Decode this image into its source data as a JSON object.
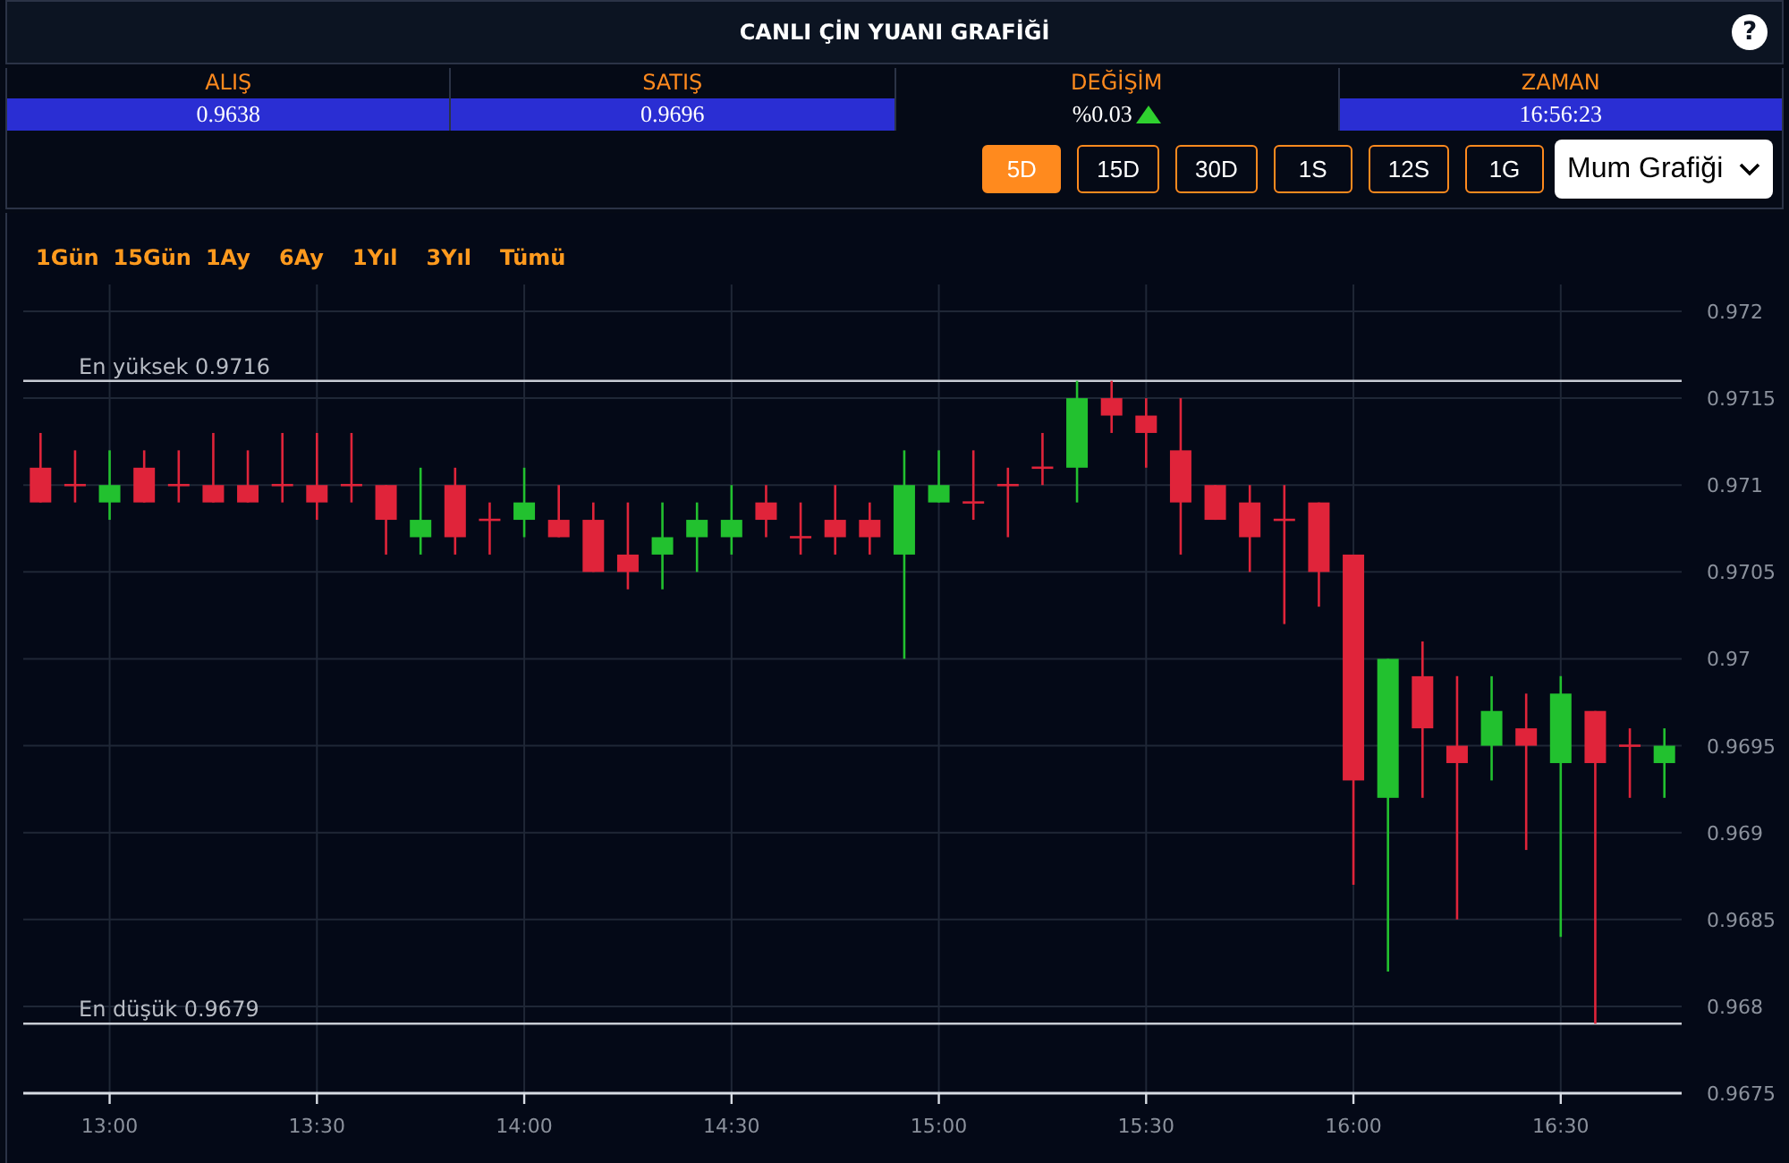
{
  "header": {
    "title": "CANLI ÇİN YUANI GRAFİĞİ",
    "help": "?"
  },
  "quotes": [
    {
      "label": "ALIŞ",
      "value": "0.9638",
      "highlighted": true,
      "up_arrow": false
    },
    {
      "label": "SATIŞ",
      "value": "0.9696",
      "highlighted": true,
      "up_arrow": false
    },
    {
      "label": "DEĞİŞİM",
      "value": "%0.03",
      "highlighted": false,
      "up_arrow": true
    },
    {
      "label": "ZAMAN",
      "value": "16:56:23",
      "highlighted": true,
      "up_arrow": false
    }
  ],
  "periods": [
    {
      "label": "5D",
      "selected": true
    },
    {
      "label": "15D",
      "selected": false
    },
    {
      "label": "30D",
      "selected": false
    },
    {
      "label": "1S",
      "selected": false
    },
    {
      "label": "12S",
      "selected": false
    },
    {
      "label": "1G",
      "selected": false
    }
  ],
  "chart_type": {
    "value": "Mum Grafiği"
  },
  "ranges": [
    {
      "label": "1Gün"
    },
    {
      "label": "15Gün"
    },
    {
      "label": "1Ay"
    },
    {
      "label": "6Ay"
    },
    {
      "label": "1Yıl"
    },
    {
      "label": "3Yıl"
    },
    {
      "label": "Tümü"
    }
  ],
  "chart_data": {
    "type": "candlestick",
    "grid": true,
    "x": [
      770,
      775,
      780,
      785,
      790,
      795,
      800,
      805,
      810,
      815,
      820,
      825,
      830,
      835,
      840,
      845,
      850,
      855,
      860,
      865,
      870,
      875,
      880,
      885,
      890,
      895,
      900,
      905,
      910,
      915,
      920,
      925,
      930,
      935,
      940,
      945,
      950,
      955,
      960,
      965,
      970,
      975,
      980,
      985,
      990,
      995,
      1000,
      1005
    ],
    "ohlc": [
      [
        0.9711,
        0.9713,
        0.9709,
        0.9709
      ],
      [
        0.971,
        0.9712,
        0.9709,
        0.971
      ],
      [
        0.9709,
        0.9712,
        0.9708,
        0.971
      ],
      [
        0.9711,
        0.9712,
        0.9709,
        0.9709
      ],
      [
        0.971,
        0.9712,
        0.9709,
        0.971
      ],
      [
        0.971,
        0.9713,
        0.9709,
        0.9709
      ],
      [
        0.971,
        0.9712,
        0.9709,
        0.9709
      ],
      [
        0.971,
        0.9713,
        0.9709,
        0.971
      ],
      [
        0.971,
        0.9713,
        0.9708,
        0.9709
      ],
      [
        0.971,
        0.9713,
        0.9709,
        0.971
      ],
      [
        0.971,
        0.971,
        0.9706,
        0.9708
      ],
      [
        0.9707,
        0.9711,
        0.9706,
        0.9708
      ],
      [
        0.971,
        0.9711,
        0.9706,
        0.9707
      ],
      [
        0.9708,
        0.9709,
        0.9706,
        0.9708
      ],
      [
        0.9708,
        0.9711,
        0.9707,
        0.9709
      ],
      [
        0.9708,
        0.971,
        0.9707,
        0.9707
      ],
      [
        0.9708,
        0.9709,
        0.9705,
        0.9705
      ],
      [
        0.9706,
        0.9709,
        0.9704,
        0.9705
      ],
      [
        0.9706,
        0.9709,
        0.9704,
        0.9707
      ],
      [
        0.9707,
        0.9709,
        0.9705,
        0.9708
      ],
      [
        0.9707,
        0.971,
        0.9706,
        0.9708
      ],
      [
        0.9709,
        0.971,
        0.9707,
        0.9708
      ],
      [
        0.9707,
        0.9709,
        0.9706,
        0.9707
      ],
      [
        0.9708,
        0.971,
        0.9706,
        0.9707
      ],
      [
        0.9708,
        0.9709,
        0.9706,
        0.9707
      ],
      [
        0.9706,
        0.9712,
        0.97,
        0.971
      ],
      [
        0.9709,
        0.9712,
        0.9709,
        0.971
      ],
      [
        0.9709,
        0.9712,
        0.9708,
        0.9709
      ],
      [
        0.971,
        0.9711,
        0.9707,
        0.971
      ],
      [
        0.9711,
        0.9713,
        0.971,
        0.9711
      ],
      [
        0.9711,
        0.9716,
        0.9709,
        0.9715
      ],
      [
        0.9715,
        0.9716,
        0.9713,
        0.9714
      ],
      [
        0.9714,
        0.9715,
        0.9711,
        0.9713
      ],
      [
        0.9712,
        0.9715,
        0.9706,
        0.9709
      ],
      [
        0.971,
        0.971,
        0.9708,
        0.9708
      ],
      [
        0.9709,
        0.971,
        0.9705,
        0.9707
      ],
      [
        0.9708,
        0.971,
        0.9702,
        0.9708
      ],
      [
        0.9709,
        0.9709,
        0.9703,
        0.9705
      ],
      [
        0.9706,
        0.9706,
        0.9687,
        0.9693
      ],
      [
        0.9692,
        0.97,
        0.9682,
        0.97
      ],
      [
        0.9699,
        0.9701,
        0.9692,
        0.9696
      ],
      [
        0.9695,
        0.9699,
        0.9685,
        0.9694
      ],
      [
        0.9695,
        0.9699,
        0.9693,
        0.9697
      ],
      [
        0.9696,
        0.9698,
        0.9689,
        0.9695
      ],
      [
        0.9694,
        0.9699,
        0.9684,
        0.9698
      ],
      [
        0.9697,
        0.9697,
        0.9679,
        0.9694
      ],
      [
        0.9695,
        0.9696,
        0.9692,
        0.9695
      ],
      [
        0.9694,
        0.9696,
        0.9692,
        0.9695
      ]
    ],
    "xlim": [
      767.5,
      1007.5
    ],
    "ylim": [
      0.9675,
      0.972
    ],
    "yticks": [
      0.972,
      0.9715,
      0.971,
      0.9705,
      0.97,
      0.9695,
      0.969,
      0.9685,
      0.968,
      0.9675
    ],
    "xticks": [
      {
        "value": 780,
        "label": "13:00"
      },
      {
        "value": 810,
        "label": "13:30"
      },
      {
        "value": 840,
        "label": "14:00"
      },
      {
        "value": 870,
        "label": "14:30"
      },
      {
        "value": 900,
        "label": "15:00"
      },
      {
        "value": 930,
        "label": "15:30"
      },
      {
        "value": 960,
        "label": "16:00"
      },
      {
        "value": 990,
        "label": "16:30"
      }
    ],
    "ref_lines": [
      {
        "axis": "y",
        "value": 0.9716,
        "label": "En yüksek 0.9716"
      },
      {
        "axis": "y",
        "value": 0.9679,
        "label": "En düşük 0.9679"
      }
    ]
  }
}
